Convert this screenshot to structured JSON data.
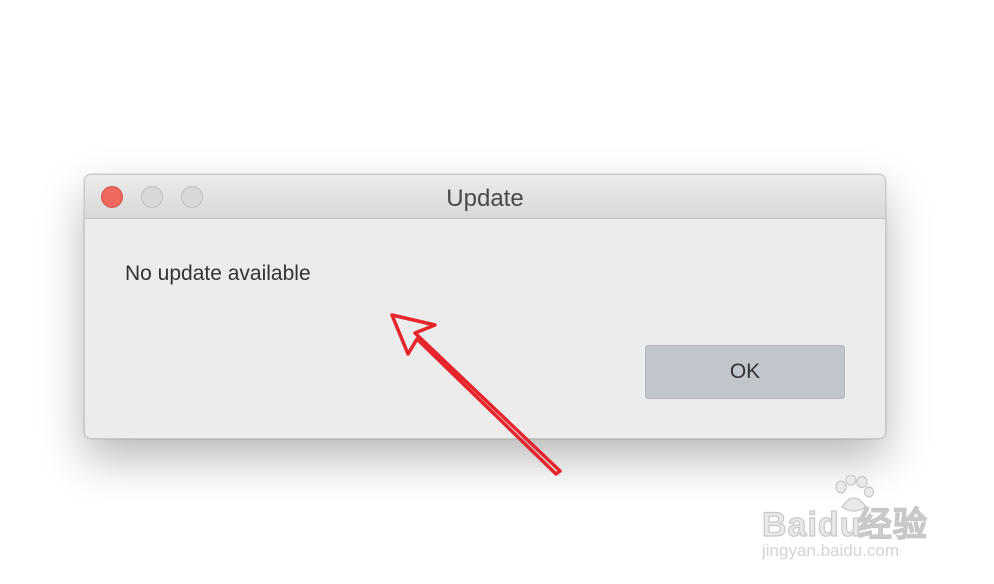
{
  "dialog": {
    "title": "Update",
    "message": "No update available",
    "ok_label": "OK",
    "window_controls": {
      "close": "close-button",
      "minimize": "minimize-button",
      "zoom": "zoom-button"
    }
  },
  "annotation": {
    "arrow_color": "#e8242c"
  },
  "watermark": {
    "brand": "Bai",
    "brand_suffix": "du",
    "product": "经验",
    "url": "jingyan.baidu.com"
  }
}
